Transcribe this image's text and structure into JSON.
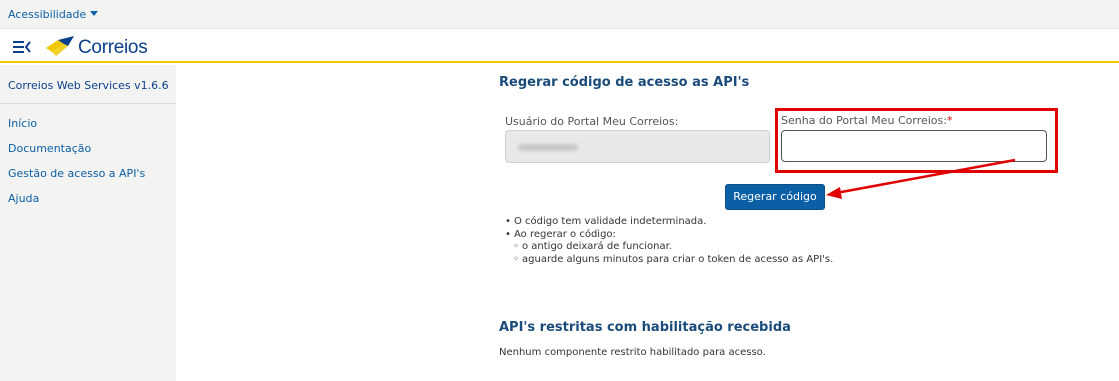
{
  "topbar": {
    "accessibility_label": "Acessibilidade"
  },
  "header": {
    "brand": "Correios"
  },
  "sidebar": {
    "title": "Correios Web Services v1.6.6",
    "items": [
      {
        "label": "Início"
      },
      {
        "label": "Documentação"
      },
      {
        "label": "Gestão de acesso a API's"
      },
      {
        "label": "Ajuda"
      }
    ]
  },
  "main": {
    "title": "Regerar código de acesso as API's",
    "user_label": "Usuário do Portal Meu Correios:",
    "user_value": "",
    "password_label": "Senha do Portal Meu Correios:",
    "password_required_mark": "*",
    "password_value": "",
    "regenerate_button": "Regerar código",
    "notes": {
      "validity": "O código tem validade indeterminada.",
      "on_regenerate": "Ao regerar o código:",
      "old_stops": "o antigo deixará de funcionar.",
      "wait_minutes": "aguarde alguns minutos para criar o token de acesso as API's."
    },
    "restricted_title": "API's restritas com habilitação recebida",
    "restricted_text": "Nenhum componente restrito habilitado para acesso."
  },
  "colors": {
    "link_blue": "#0b5fa5",
    "header_accent": "#f0c800",
    "highlight_red": "#e10000",
    "button_blue": "#0b5fa5"
  },
  "icons": [
    "menu-collapse-icon",
    "correios-logo",
    "caret-down-icon",
    "annotation-arrow"
  ]
}
